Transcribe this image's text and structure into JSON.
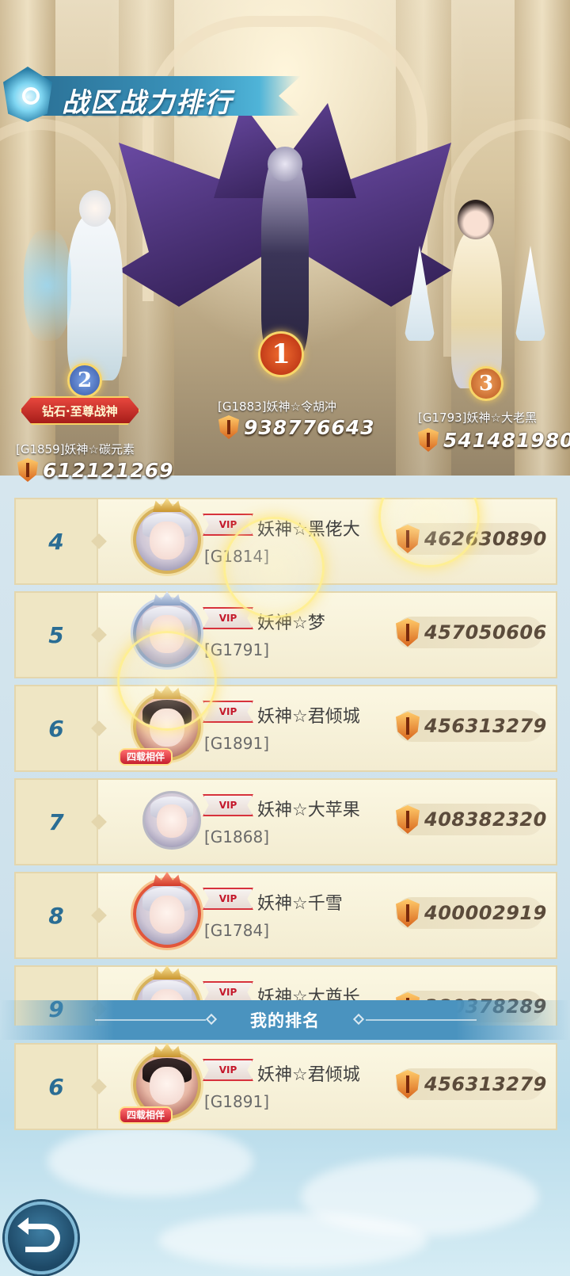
{
  "header": {
    "title": "战区战力排行"
  },
  "podium": [
    {
      "rank": "1",
      "name": "[G1883]妖神☆令胡冲",
      "power": "938776643"
    },
    {
      "rank": "2",
      "title_plate": "钻石·至尊战神",
      "name": "[G1859]妖神☆碳元素",
      "power": "612121269"
    },
    {
      "rank": "3",
      "name": "[G1793]妖神☆大老黑",
      "power": "541481980"
    }
  ],
  "list": [
    {
      "rank": "4",
      "vip": "VIP",
      "name": "妖神☆黑佬大",
      "server": "[G1814]",
      "power": "462630890"
    },
    {
      "rank": "5",
      "vip": "VIP",
      "name": "妖神☆梦",
      "server": "[G1791]",
      "power": "457050606"
    },
    {
      "rank": "6",
      "vip": "VIP",
      "name": "妖神☆君倾城",
      "server": "[G1891]",
      "power": "456313279",
      "frame_tag": "四载相伴"
    },
    {
      "rank": "7",
      "vip": "VIP",
      "name": "妖神☆大苹果",
      "server": "[G1868]",
      "power": "408382320"
    },
    {
      "rank": "8",
      "vip": "VIP",
      "name": "妖神☆千雪",
      "server": "[G1784]",
      "power": "400002919"
    },
    {
      "rank": "9",
      "vip": "VIP",
      "name": "妖神☆大酋长",
      "server": "",
      "power": "380378289"
    }
  ],
  "my_rank": {
    "label": "我的排名",
    "rank": "6",
    "vip": "VIP",
    "name": "妖神☆君倾城",
    "server": "[G1891]",
    "power": "456313279",
    "frame_tag": "四载相伴"
  },
  "icons": {
    "power": "shield-power-icon",
    "back": "back-arrow-icon"
  },
  "colors": {
    "rank_number": "#2a6d94",
    "title_ribbon": "#3a93bb",
    "row_bg": "#f6f0d8",
    "power_text": "#5b4b3b"
  }
}
